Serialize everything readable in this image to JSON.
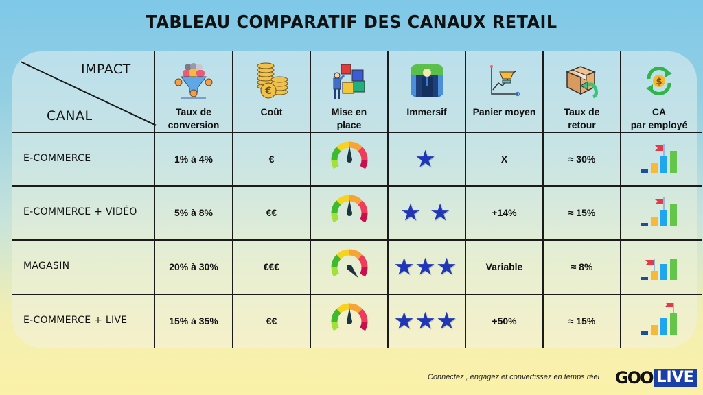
{
  "title": "TABLEAU COMPARATIF DES CANAUX RETAIL",
  "corner": {
    "top": "IMPACT",
    "bottom": "CANAL"
  },
  "columns": [
    {
      "label": "Taux de\nconversion",
      "icon": "conversion-funnel-icon"
    },
    {
      "label": "Coût",
      "icon": "euro-coins-icon"
    },
    {
      "label": "Mise en\nplace",
      "icon": "puzzle-setup-icon"
    },
    {
      "label": "Immersif",
      "icon": "immersive-person-icon"
    },
    {
      "label": "Panier moyen",
      "icon": "cart-growth-chart-icon"
    },
    {
      "label": "Taux de\nretour",
      "icon": "return-box-icon"
    },
    {
      "label": "CA\npar employé",
      "icon": "revenue-cycle-icon"
    }
  ],
  "rows": [
    {
      "canal": "E-COMMERCE",
      "conversion": "1% à 4%",
      "cout": "€",
      "mise_en_place_gauge": "medium",
      "immersif_stars": "★",
      "immersif_rating": 1,
      "panier": "X",
      "retour": "≈ 30%",
      "ca_flag_bar": 3
    },
    {
      "canal": "E-COMMERCE + VIDÉO",
      "conversion": "5% à 8%",
      "cout": "€€",
      "mise_en_place_gauge": "medium",
      "immersif_stars": "★ ★",
      "immersif_rating": 2,
      "panier": "+14%",
      "retour": "≈ 15%",
      "ca_flag_bar": 3
    },
    {
      "canal": "MAGASIN",
      "conversion": "20% à 30%",
      "cout": "€€€",
      "mise_en_place_gauge": "high",
      "immersif_stars": "★★★",
      "immersif_rating": 3,
      "panier": "Variable",
      "retour": "≈ 8%",
      "ca_flag_bar": 2
    },
    {
      "canal": "E-COMMERCE + LIVE",
      "conversion": "15% à 35%",
      "cout": "€€",
      "mise_en_place_gauge": "medium",
      "immersif_stars": "★★★",
      "immersif_rating": 3,
      "panier": "+50%",
      "retour": "≈ 15%",
      "ca_flag_bar": 4
    }
  ],
  "footer": {
    "tagline": "Connectez , engagez et convertissez en temps réel",
    "logo_left": "GOO",
    "logo_right": "LIVE"
  },
  "colors": {
    "star": "#1f36b8",
    "logo_bg": "#1a3fa8",
    "gauge": [
      "#a4e03a",
      "#3dbb2c",
      "#f7d21e",
      "#f8a435",
      "#ef3c5a",
      "#c8104f"
    ],
    "bars": [
      "#1b4f9c",
      "#f6b93b",
      "#1ea7ee",
      "#63c54a"
    ],
    "flag": "#e23a4b"
  }
}
